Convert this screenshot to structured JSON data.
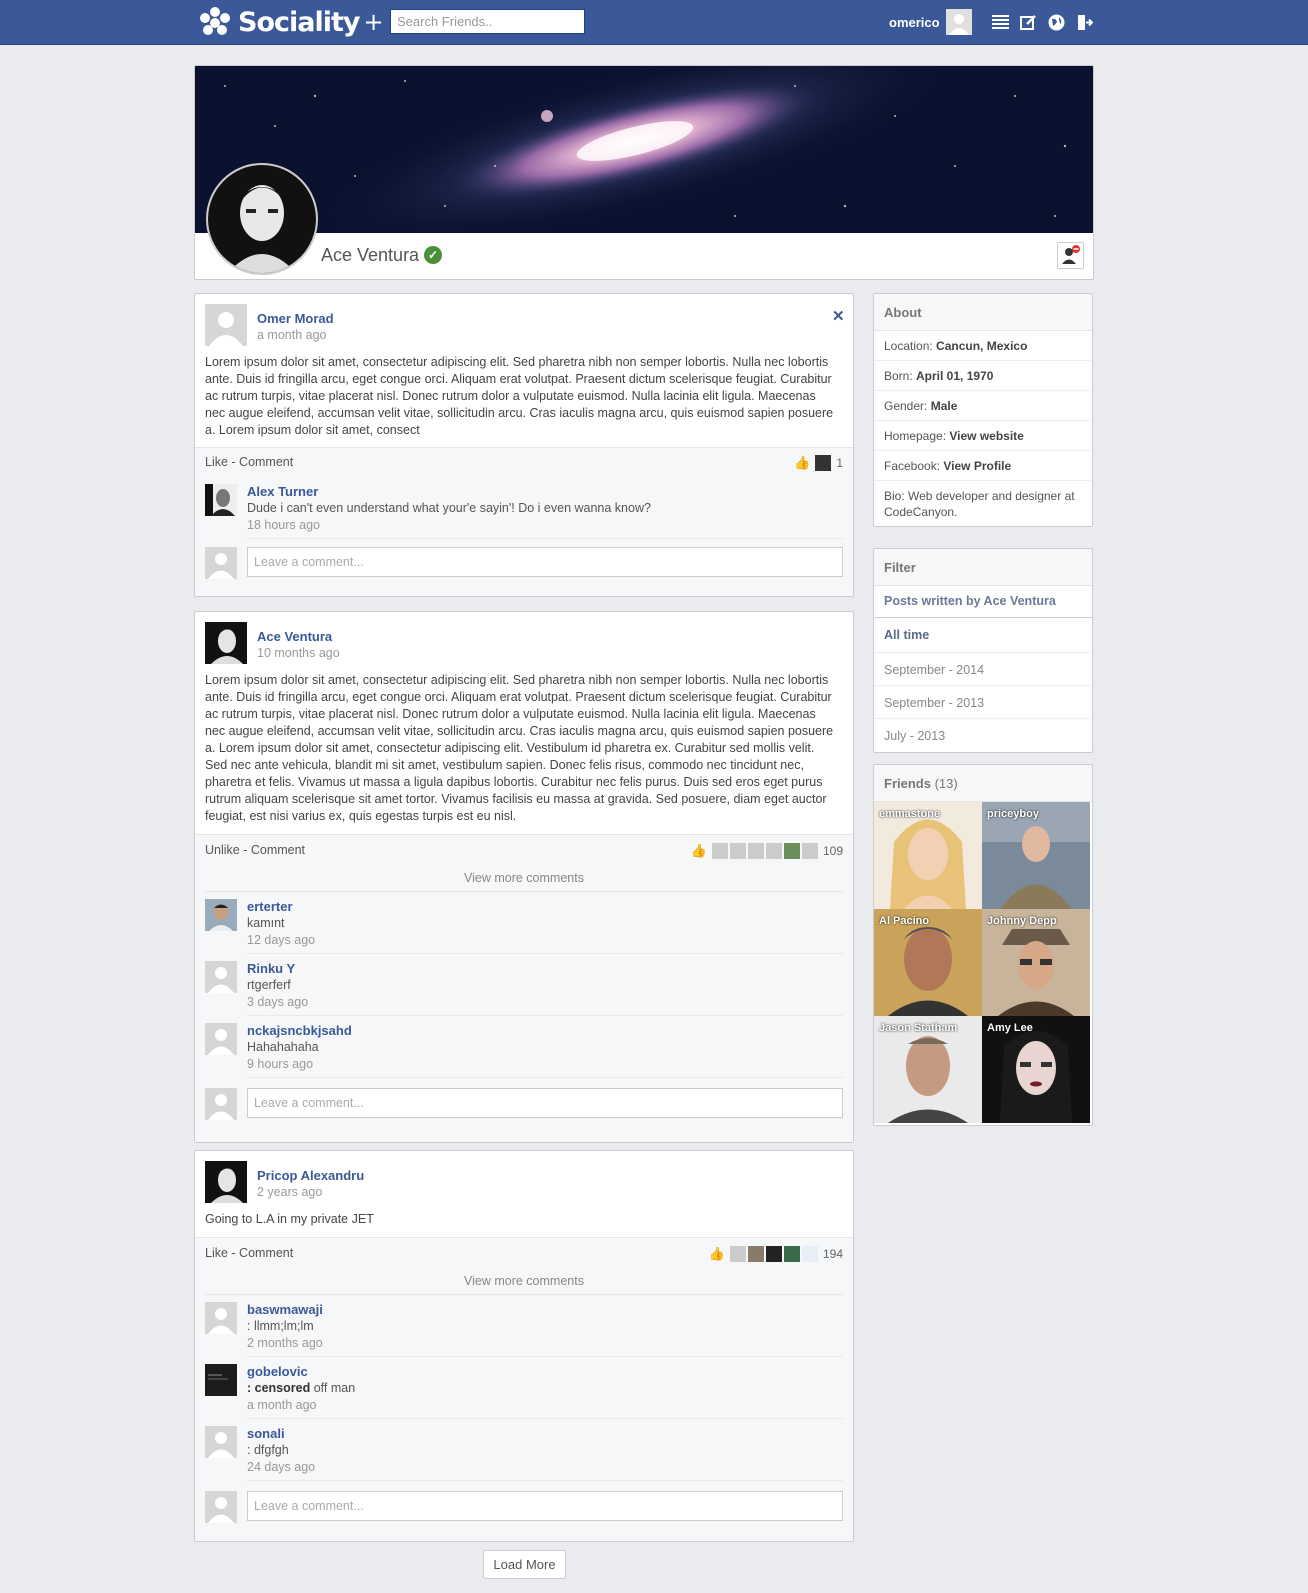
{
  "header": {
    "brand": "Sociality",
    "brand_plus": "+",
    "search_placeholder": "Search Friends..",
    "username": "omerico",
    "icons": [
      "menu-icon",
      "edit-icon",
      "globe-icon",
      "logout-icon"
    ],
    "bar_color": "#3b5998"
  },
  "profile": {
    "name": "Ace Ventura",
    "verified": true
  },
  "posts": [
    {
      "author": "Omer Morad",
      "time": "a month ago",
      "text": "Lorem ipsum dolor sit amet, consectetur adipiscing elit. Sed pharetra nibh non semper lobortis. Nulla nec lobortis ante. Duis id fringilla arcu, eget congue orci. Aliquam erat volutpat. Praesent dictum scelerisque feugiat. Curabitur ac rutrum turpis, vitae placerat nisl. Donec rutrum dolor a vulputate euismod. Nulla lacinia elit ligula. Maecenas nec augue eleifend, accumsan velit vitae, sollicitudin arcu. Cras iaculis magna arcu, quis euismod sapien posuere a. Lorem ipsum dolor sit amet, consect",
      "actions": "Like - Comment",
      "like_count": "1",
      "view_more": "",
      "comments": [
        {
          "author": "Alex Turner",
          "text": "Dude i can't even understand what your'e sayin'! Do i even wanna know?",
          "time": "18 hours ago"
        }
      ],
      "comment_placeholder": "Leave a comment..."
    },
    {
      "author": "Ace Ventura",
      "time": "10 months ago",
      "text": "Lorem ipsum dolor sit amet, consectetur adipiscing elit. Sed pharetra nibh non semper lobortis. Nulla nec lobortis ante. Duis id fringilla arcu, eget congue orci. Aliquam erat volutpat. Praesent dictum scelerisque feugiat. Curabitur ac rutrum turpis, vitae placerat nisl. Donec rutrum dolor a vulputate euismod. Nulla lacinia elit ligula. Maecenas nec augue eleifend, accumsan velit vitae, sollicitudin arcu. Cras iaculis magna arcu, quis euismod sapien posuere a. Lorem ipsum dolor sit amet, consectetur adipiscing elit. Vestibulum id pharetra ex. Curabitur sed mollis velit. Sed nec ante vehicula, blandit mi sit amet, vestibulum sapien. Donec felis risus, commodo nec tincidunt nec, pharetra et felis. Vivamus ut massa a ligula dapibus lobortis. Curabitur nec felis purus. Duis sed eros eget purus rutrum aliquam scelerisque sit amet tortor. Vivamus facilisis eu massa at gravida. Sed posuere, diam eget auctor feugiat, est nisi varius ex, quis egestas turpis est eu nisl.",
      "actions": "Unlike - Comment",
      "like_count": "109",
      "view_more": "View more comments",
      "comments": [
        {
          "author": "erterter",
          "text": "kamınt",
          "time": "12 days ago"
        },
        {
          "author": "Rinku Y",
          "text": "rtgerferf",
          "time": "3 days ago"
        },
        {
          "author": "nckajsncbkjsahd",
          "text": "Hahahahaha",
          "time": "9 hours ago"
        }
      ],
      "comment_placeholder": "Leave a comment..."
    },
    {
      "author": "Pricop Alexandru",
      "time": "2 years ago",
      "text": "Going to L.A in my private JET",
      "actions": "Like - Comment",
      "like_count": "194",
      "view_more": "View more comments",
      "comments": [
        {
          "author": "baswmawaji",
          "text": ": llmm;lm;lm",
          "time": "2 months ago"
        },
        {
          "author": "gobelovic",
          "text_bold": ": censored",
          "text": " off man",
          "time": "a month ago"
        },
        {
          "author": "sonali",
          "text": ": dfgfgh",
          "time": "24 days ago"
        }
      ],
      "comment_placeholder": "Leave a comment..."
    }
  ],
  "about": {
    "title": "About",
    "rows": [
      {
        "label": "Location: ",
        "value": "Cancun, Mexico"
      },
      {
        "label": "Born: ",
        "value": "April 01, 1970"
      },
      {
        "label": "Gender: ",
        "value": "Male"
      },
      {
        "label": "Homepage: ",
        "value": "View website"
      },
      {
        "label": "Facebook: ",
        "value": "View Profile"
      }
    ],
    "bio": "Bio: Web developer and designer at CodeCanyon."
  },
  "filter": {
    "title": "Filter",
    "posts_by": "Posts written by Ace Ventura",
    "items": [
      "All time",
      "September - 2014",
      "September - 2013",
      "July - 2013"
    ]
  },
  "friends": {
    "title": "Friends",
    "count": "(13)",
    "list": [
      "emmastone",
      "priceyboy",
      "Al Pacino",
      "Johnny Depp",
      "Jason Statham",
      "Amy Lee"
    ]
  },
  "load_more": "Load More"
}
